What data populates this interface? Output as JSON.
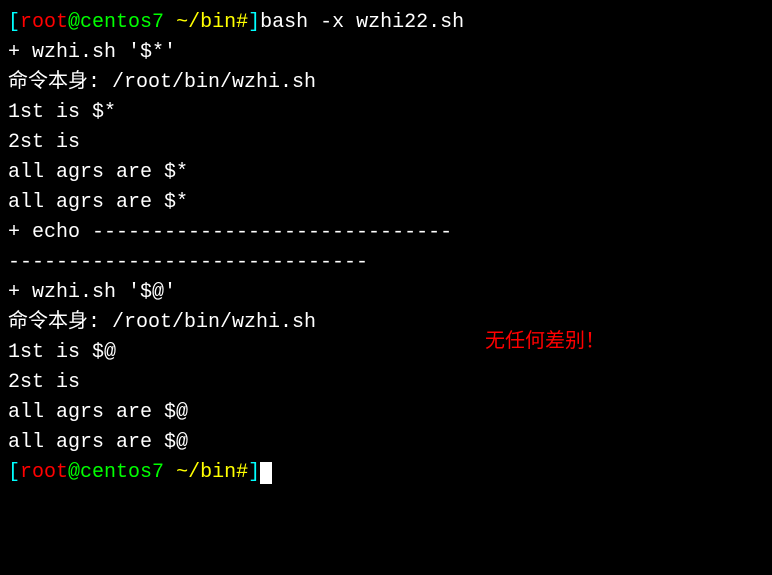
{
  "lines": {
    "l1_bracket_open": "[",
    "l1_user": "root",
    "l1_at": "@",
    "l1_host": "centos7 ",
    "l1_path": "~/bin#",
    "l1_bracket_close": "]",
    "l1_command": "bash -x wzhi22.sh",
    "l2": "+ wzhi.sh '$*'",
    "l3": "命令本身: /root/bin/wzhi.sh",
    "l4": "1st is $*",
    "l5": "2st is",
    "l6": "all agrs are $*",
    "l7": "all agrs are $*",
    "l8": "+ echo ------------------------------",
    "l9": "------------------------------",
    "l10": "+ wzhi.sh '$@'",
    "l11": "命令本身: /root/bin/wzhi.sh",
    "l12": "1st is $@",
    "l13": "2st is",
    "l14": "all agrs are $@",
    "l15": "all agrs are $@",
    "l16_bracket_open": "[",
    "l16_user": "root",
    "l16_at": "@",
    "l16_host": "centos7 ",
    "l16_path": "~/bin#",
    "l16_bracket_close": "]"
  },
  "annotation": "无任何差别！"
}
